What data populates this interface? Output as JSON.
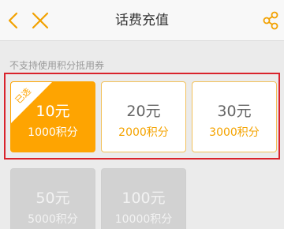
{
  "header": {
    "title": "话费充值"
  },
  "notice": "不支持使用积分抵用券",
  "options": [
    {
      "amount": "10元",
      "points": "1000积分",
      "selected": true,
      "badge": "已选"
    },
    {
      "amount": "20元",
      "points": "2000积分"
    },
    {
      "amount": "30元",
      "points": "3000积分"
    },
    {
      "amount": "50元",
      "points": "5000积分"
    },
    {
      "amount": "100元",
      "points": "10000积分"
    }
  ],
  "colors": {
    "accent": "#fea401",
    "highlight_border": "#d9232c",
    "disabled": "#d2d2d2"
  },
  "icons": {
    "back": "chevron-left-icon",
    "close": "close-icon",
    "share": "share-icon"
  }
}
